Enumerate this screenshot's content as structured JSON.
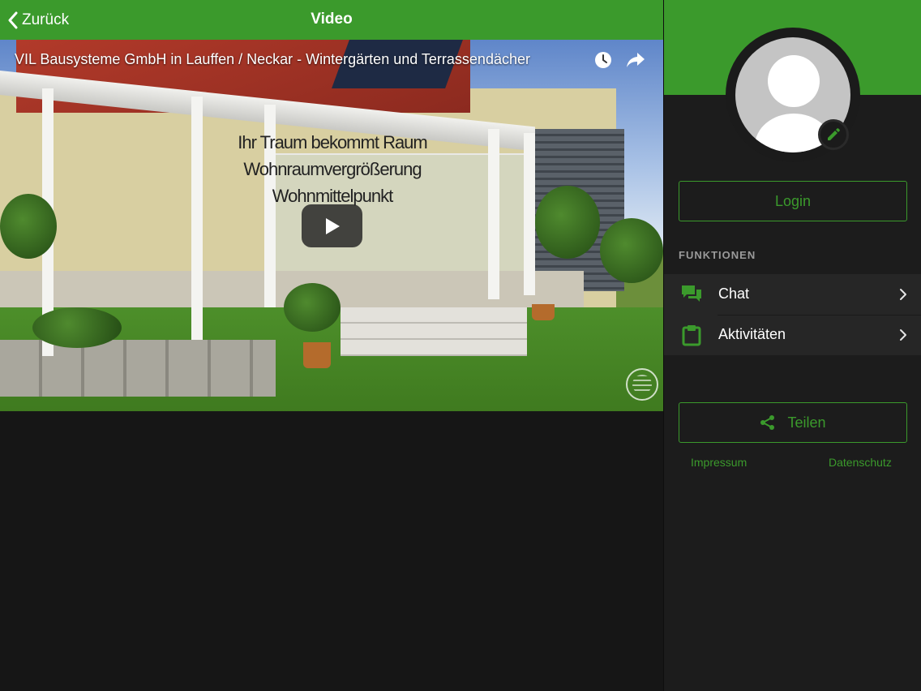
{
  "header": {
    "back_label": "Zurück",
    "title": "Video"
  },
  "video": {
    "title": "VIL Bausysteme GmbH in Lauffen / Neckar - Wintergärten und Terrassendächer",
    "caption_lines": [
      "Ihr Traum bekommt Raum",
      "Wohnraumvergrößerung",
      "Wohnmittelpunkt"
    ]
  },
  "sidebar": {
    "login_label": "Login",
    "section_label": "FUNKTIONEN",
    "items": [
      {
        "label": "Chat",
        "icon": "chat-icon"
      },
      {
        "label": "Aktivitäten",
        "icon": "clipboard-icon"
      }
    ],
    "share_label": "Teilen",
    "impressum_label": "Impressum",
    "datenschutz_label": "Datenschutz"
  },
  "colors": {
    "accent": "#3b9a2c",
    "background": "#161616",
    "panel": "#1c1c1c"
  }
}
